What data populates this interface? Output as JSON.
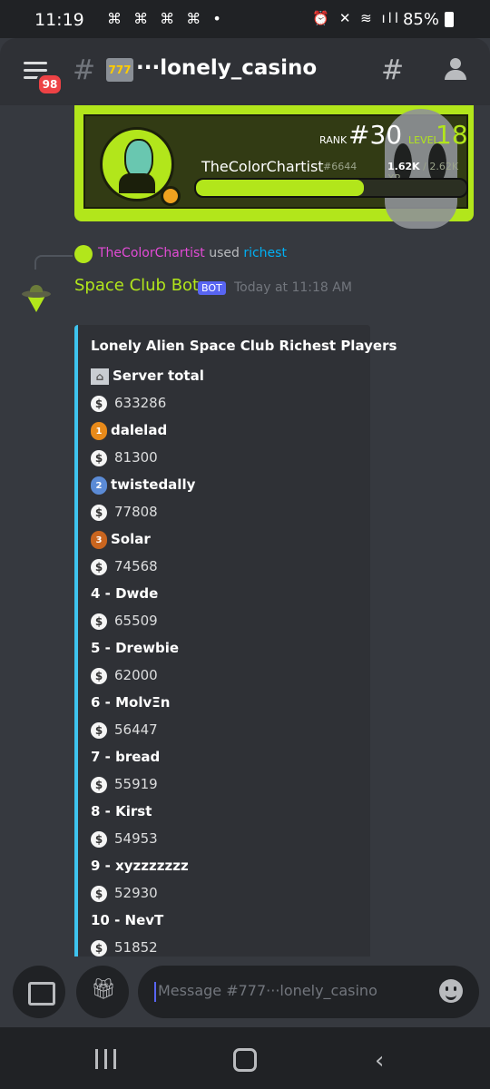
{
  "status": {
    "time": "11:19",
    "notifications": "⌘ ⌘ ⌘ ⌘ •",
    "battery": "85%"
  },
  "header": {
    "unread_badge": "98",
    "channel_emoji": "777",
    "channel_title": "···lonely_casino"
  },
  "rank_card": {
    "rank_label": "RANK",
    "rank": "#30",
    "level_label": "LEVEL",
    "level": "18",
    "username": "TheColorChartist",
    "discriminator": "#6644",
    "xp_current": "1.62K",
    "xp_total": "/ 2.62K XP",
    "progress_fraction": 0.62
  },
  "reply": {
    "user": "TheColorChartist",
    "used": "used",
    "command": "richest"
  },
  "message": {
    "author": "Space Club Bot",
    "bot_tag": "BOT",
    "timestamp": "Today at 11:18 AM"
  },
  "embed": {
    "title": "Lonely Alien Space Club Richest Players",
    "entries": [
      {
        "name": "Server total",
        "value": "633286"
      },
      {
        "name": "dalelad",
        "value": "81300"
      },
      {
        "name": "twistedally",
        "value": "77808"
      },
      {
        "name": "Solar",
        "value": "74568"
      },
      {
        "name": "4 - Dwde",
        "value": "65509"
      },
      {
        "name": "5 - Drewbie",
        "value": "62000"
      },
      {
        "name": "6 - MolvΞn",
        "value": "56447"
      },
      {
        "name": "7 - bread",
        "value": "55919"
      },
      {
        "name": "8 - Kirst",
        "value": "54953"
      },
      {
        "name": "9 - xyzzzzzzz",
        "value": "52930"
      },
      {
        "name": "10 - NevT",
        "value": "51852"
      }
    ],
    "medals": [
      "1",
      "2",
      "3"
    ]
  },
  "composer": {
    "placeholder": "Message #777···lonely_casino"
  },
  "colors": {
    "accent_lime": "#b2e61b",
    "embed_bar": "#3ec3ee",
    "blurple": "#5865f2"
  }
}
